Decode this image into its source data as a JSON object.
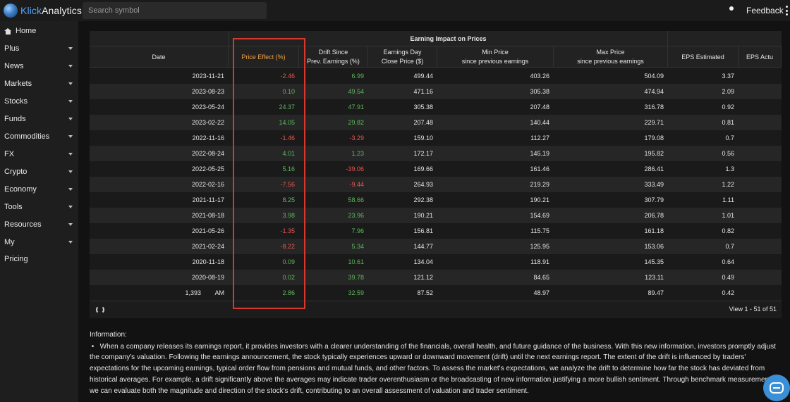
{
  "app": {
    "logo_prefix": "Klick",
    "logo_suffix": "Analytics",
    "search_placeholder": "Search symbol",
    "feedback_label": "Feedback"
  },
  "sidebar": {
    "items": [
      {
        "label": "Home",
        "icon": "home-icon",
        "has_caret": false
      },
      {
        "label": "Plus",
        "has_caret": true
      },
      {
        "label": "News",
        "has_caret": true
      },
      {
        "label": "Markets",
        "has_caret": true
      },
      {
        "label": "Stocks",
        "has_caret": true
      },
      {
        "label": "Funds",
        "has_caret": true
      },
      {
        "label": "Commodities",
        "has_caret": true
      },
      {
        "label": "FX",
        "has_caret": true
      },
      {
        "label": "Crypto",
        "has_caret": true
      },
      {
        "label": "Economy",
        "has_caret": true
      },
      {
        "label": "Tools",
        "has_caret": true
      },
      {
        "label": "Resources",
        "has_caret": true
      },
      {
        "label": "My",
        "has_caret": true
      },
      {
        "label": "Pricing",
        "has_caret": false
      }
    ]
  },
  "table": {
    "group_header": "Earning Impact on Prices",
    "columns": [
      {
        "key": "date",
        "label": "Date"
      },
      {
        "key": "price_effect",
        "label": "Price Effect (%)"
      },
      {
        "key": "drift",
        "label": "Drift Since\nPrev. Earnings (%)"
      },
      {
        "key": "close",
        "label": "Earnings Day\nClose Price ($)"
      },
      {
        "key": "min",
        "label": "Min Price\nsince previous earnings"
      },
      {
        "key": "max",
        "label": "Max Price\nsince previous earnings"
      },
      {
        "key": "eps_est",
        "label": "EPS Estimated"
      },
      {
        "key": "eps_act",
        "label": "EPS Actu"
      }
    ],
    "rows": [
      {
        "date": "2023-11-21",
        "price_effect": "-2.46",
        "drift": "6.99",
        "close": "499.44",
        "min": "403.26",
        "max": "504.09",
        "eps_est": "3.37"
      },
      {
        "date": "2023-08-23",
        "price_effect": "0.10",
        "drift": "49.54",
        "close": "471.16",
        "min": "305.38",
        "max": "474.94",
        "eps_est": "2.09"
      },
      {
        "date": "2023-05-24",
        "price_effect": "24.37",
        "drift": "47.91",
        "close": "305.38",
        "min": "207.48",
        "max": "316.78",
        "eps_est": "0.92"
      },
      {
        "date": "2023-02-22",
        "price_effect": "14.05",
        "drift": "29.82",
        "close": "207.48",
        "min": "140.44",
        "max": "229.71",
        "eps_est": "0.81"
      },
      {
        "date": "2022-11-16",
        "price_effect": "-1.46",
        "drift": "-3.29",
        "close": "159.10",
        "min": "112.27",
        "max": "179.08",
        "eps_est": "0.7"
      },
      {
        "date": "2022-08-24",
        "price_effect": "4.01",
        "drift": "1.23",
        "close": "172.17",
        "min": "145.19",
        "max": "195.82",
        "eps_est": "0.56"
      },
      {
        "date": "2022-05-25",
        "price_effect": "5.16",
        "drift": "-39.06",
        "close": "169.66",
        "min": "161.46",
        "max": "286.41",
        "eps_est": "1.3"
      },
      {
        "date": "2022-02-16",
        "price_effect": "-7.56",
        "drift": "-9.44",
        "close": "264.93",
        "min": "219.29",
        "max": "333.49",
        "eps_est": "1.22"
      },
      {
        "date": "2021-11-17",
        "price_effect": "8.25",
        "drift": "58.66",
        "close": "292.38",
        "min": "190.21",
        "max": "307.79",
        "eps_est": "1.11"
      },
      {
        "date": "2021-08-18",
        "price_effect": "3.98",
        "drift": "23.96",
        "close": "190.21",
        "min": "154.69",
        "max": "206.78",
        "eps_est": "1.01"
      },
      {
        "date": "2021-05-26",
        "price_effect": "-1.35",
        "drift": "7.96",
        "close": "156.81",
        "min": "115.75",
        "max": "161.18",
        "eps_est": "0.82"
      },
      {
        "date": "2021-02-24",
        "price_effect": "-8.22",
        "drift": "5.34",
        "close": "144.77",
        "min": "125.95",
        "max": "153.06",
        "eps_est": "0.7"
      },
      {
        "date": "2020-11-18",
        "price_effect": "0.09",
        "drift": "10.61",
        "close": "134.04",
        "min": "118.91",
        "max": "145.35",
        "eps_est": "0.64"
      },
      {
        "date": "2020-08-19",
        "price_effect": "0.02",
        "drift": "39.78",
        "close": "121.12",
        "min": "84.65",
        "max": "123.11",
        "eps_est": "0.49"
      },
      {
        "date": "1,393        AM",
        "price_effect": "2.86",
        "drift": "32.59",
        "close": "87.52",
        "min": "48.97",
        "max": "89.47",
        "eps_est": "0.42"
      }
    ],
    "view_count": "View 1 - 51 of 51"
  },
  "information": {
    "title": "Information:",
    "text": "When a company releases its earnings report, it provides investors with a clearer understanding of the financials, overall health, and future guidance of the business. With this new information, investors promptly adjust the company's valuation. Following the earnings announcement, the stock typically experiences upward or downward movement (drift) until the next earnings report. The extent of the drift is influenced by traders' expectations for the upcoming earnings, typical order flow from pensions and mutual funds, and other factors. To assess the market's expectations, we analyze the drift to determine how far the stock has deviated from historical averages. For example, a drift significantly above the averages may indicate trader overenthusiasm or the broadcasting of new information justifying a more bullish sentiment. Through benchmark measurements, we can evaluate both the magnitude and direction of the stock's drift, contributing to an overall assessment of valuation and trader sentiment."
  },
  "colors": {
    "positive": "#5cb85c",
    "negative": "#e8584f",
    "active_header": "#f0a040",
    "highlight": "#d9382d"
  }
}
